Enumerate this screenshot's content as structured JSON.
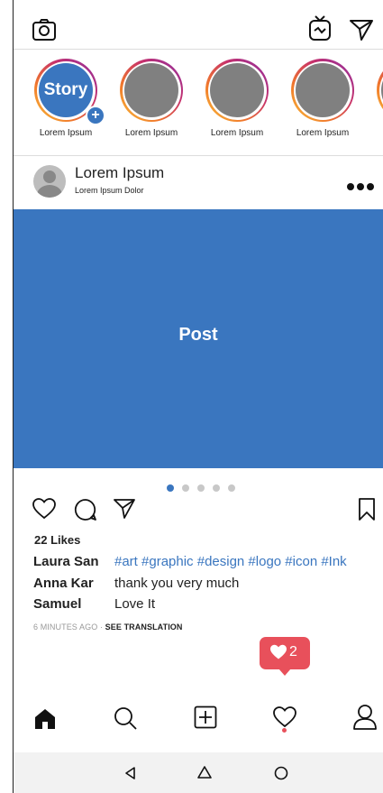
{
  "stories": [
    {
      "label": "Lorem Ipsum",
      "own": true,
      "badge": "Story"
    },
    {
      "label": "Lorem Ipsum"
    },
    {
      "label": "Lorem Ipsum"
    },
    {
      "label": "Lorem Ipsum"
    }
  ],
  "post": {
    "user": "Lorem Ipsum",
    "subtitle": "Lorem Ipsum Dolor",
    "image_label": "Post",
    "likes": "22 Likes",
    "comments": [
      {
        "user": "Laura San",
        "text": "#art #graphic #design #logo #icon #Ink"
      },
      {
        "user": "Anna Kar",
        "text": "thank you very much"
      },
      {
        "user": "Samuel",
        "text": "Love It"
      }
    ],
    "time": "6 MINUTES AGO",
    "separator": "·",
    "translate": "SEE TRANSLATION",
    "pager": {
      "count": 5,
      "active": 0
    }
  },
  "notification": {
    "count": "2"
  },
  "colors": {
    "accent": "#3a76bf",
    "notify": "#e8505b"
  }
}
